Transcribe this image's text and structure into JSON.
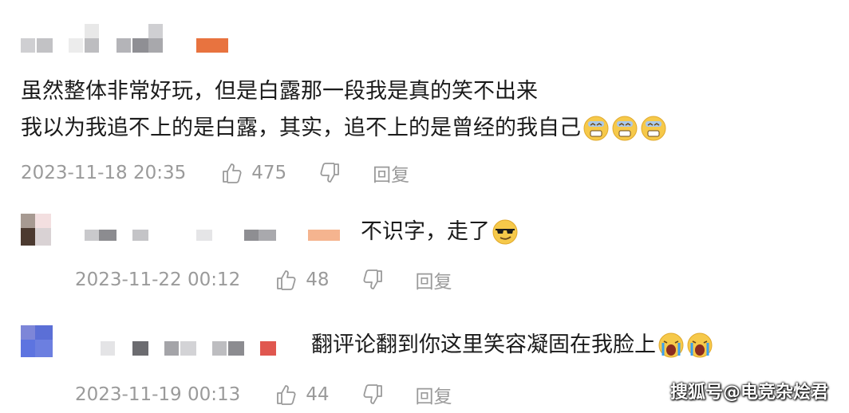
{
  "comments": [
    {
      "lines": [
        "虽然整体非常好玩，但是白露那一段我是真的笑不出来",
        "我以为我追不上的是白露，其实，追不上的是曾经的我自己"
      ],
      "emojis": [
        "tired-face-emoji",
        "tired-face-emoji",
        "tired-face-emoji"
      ],
      "time": "2023-11-18 20:35",
      "likes": "475",
      "reply_label": "回复"
    },
    {
      "lines": [
        "不识字，走了"
      ],
      "emojis": [
        "sunglasses-emoji"
      ],
      "time": "2023-11-22 00:12",
      "likes": "48",
      "reply_label": "回复"
    },
    {
      "lines": [
        "翻评论翻到你这里笑容凝固在我脸上"
      ],
      "emojis": [
        "crying-face-emoji",
        "crying-face-emoji"
      ],
      "time": "2023-11-19 00:13",
      "likes": "44",
      "reply_label": "回复"
    }
  ],
  "watermark": "搜狐号@电竞杂烩君",
  "colors": {
    "meta_text": "#9a9a9a",
    "body_text": "#1b1b1b",
    "username_accent_1": "#e8733f",
    "username_accent_2": "#f5b48f",
    "username_accent_3": "#e0574f",
    "avatar_blue": "#5b6fd6"
  }
}
